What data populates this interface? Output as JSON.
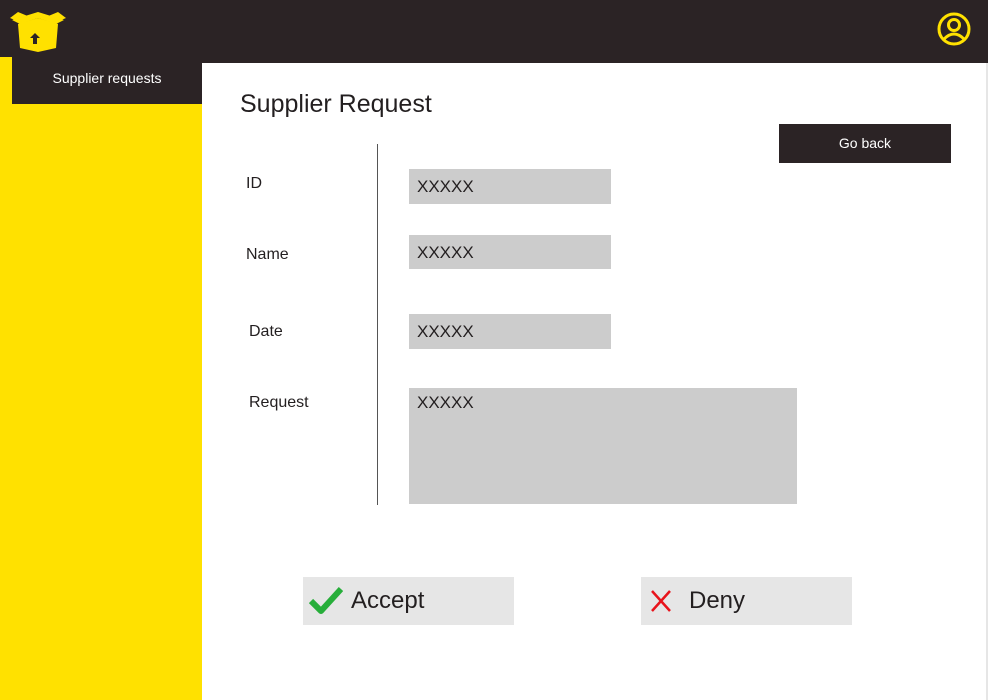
{
  "header": {
    "logo_icon": "box-logo-icon",
    "profile_icon": "user-circle-icon",
    "accent_color": "#ffe100",
    "bar_color": "#2b2325"
  },
  "sidebar": {
    "items": [
      {
        "label": "Supplier requests",
        "active": true
      }
    ]
  },
  "main": {
    "title": "Supplier Request",
    "go_back_label": "Go back",
    "fields": {
      "id": {
        "label": "ID",
        "value": "XXXXX"
      },
      "name": {
        "label": "Name",
        "value": "XXXXX"
      },
      "date": {
        "label": "Date",
        "value": "XXXXX"
      },
      "request": {
        "label": "Request",
        "value": "XXXXX"
      }
    },
    "actions": {
      "accept_label": "Accept",
      "accept_icon": "checkmark-icon",
      "accept_color": "#27ae3a",
      "deny_label": "Deny",
      "deny_icon": "x-icon",
      "deny_color": "#e8131b"
    }
  }
}
